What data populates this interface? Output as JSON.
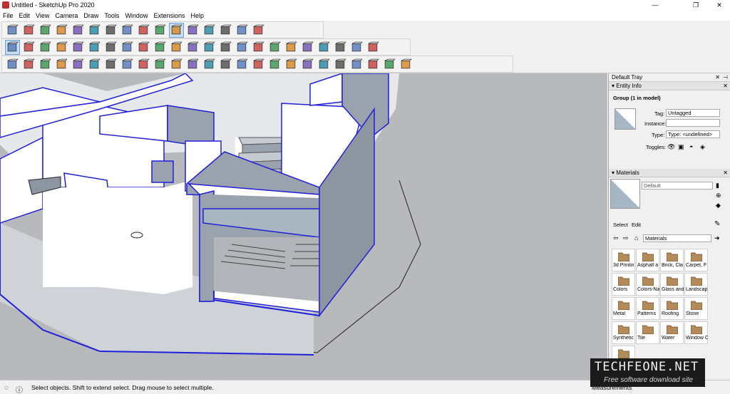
{
  "window": {
    "title": "Untitled - SketchUp Pro 2020",
    "minimize": "—",
    "maximize": "❐",
    "close": "✕"
  },
  "menu": [
    "File",
    "Edit",
    "View",
    "Camera",
    "Draw",
    "Tools",
    "Window",
    "Extensions",
    "Help"
  ],
  "toolbars": {
    "row1_icons": [
      "iso-view-icon",
      "top-view-icon",
      "front-view-icon",
      "right-view-icon",
      "back-view-icon",
      "left-view-icon",
      "xray-icon",
      "back-edges-icon",
      "wireframe-icon",
      "hidden-line-icon",
      "shaded-icon",
      "shaded-textures-icon",
      "monochrome-icon",
      "warehouse-icon",
      "ext-warehouse-icon",
      "share-model-icon"
    ],
    "row2_icons": [
      "select-icon",
      "eraser-icon",
      "pencil-icon",
      "arc-icon",
      "shape-icon",
      "paint-bucket-icon",
      "push-pull-icon",
      "follow-me-icon",
      "move-icon",
      "rotate-icon",
      "scale-icon",
      "offset-icon",
      "tape-measure-icon",
      "text-icon",
      "protractor-icon",
      "axes-icon",
      "dimension-icon",
      "zoom-icon",
      "zoom-extents-icon",
      "section-plane-icon",
      "outliner-icon",
      "instructor-icon",
      "account-icon"
    ],
    "row3_icons": [
      "sandbox-from-contours-icon",
      "sandbox-from-scratch-icon",
      "smoove-icon",
      "stamp-icon",
      "drape-icon",
      "add-detail-icon",
      "flip-edge-icon",
      "walk-icon",
      "look-around-icon",
      "position-camera-icon",
      "section-fill-icon",
      "display-sections-icon",
      "style-icon",
      "shadows-icon",
      "fog-icon",
      "2d-view-icon",
      "3d-warehouse-icon",
      "solid-tools-icon",
      "outer-shell-icon",
      "intersect-icon",
      "union-icon",
      "subtract-icon",
      "trim-icon",
      "split-icon",
      "hand-cursor-icon"
    ]
  },
  "tray": {
    "title": "Default Tray",
    "entity_info": {
      "header": "Entity Info",
      "selection": "Group (1 in model)",
      "tag_label": "Tag:",
      "tag_value": "Untagged",
      "instance_label": "Instance:",
      "instance_value": "",
      "type_label": "Type:",
      "type_value": "Type: <undefined>",
      "toggles_label": "Toggles:"
    },
    "materials": {
      "header": "Materials",
      "current": "Default",
      "tab_select": "Select",
      "tab_edit": "Edit",
      "library": "Materials",
      "categories": [
        "3d Printin",
        "Asphalt a",
        "Brick, Cla",
        "Carpet, F",
        "Colors",
        "Colors-Na",
        "Glass and",
        "Landscap",
        "Metal",
        "Patterns",
        "Roofing",
        "Stone",
        "Synthetic",
        "Tile",
        "Water",
        "Window C",
        ""
      ]
    }
  },
  "status": {
    "message": "Select objects. Shift to extend select. Drag mouse to select multiple.",
    "measurements": "Measurements"
  },
  "watermark": {
    "line1": "TECHFEONE.NET",
    "line2": "Free software download site"
  },
  "colors": {
    "accent": "#2020d8",
    "wall": "#ffffff",
    "wall_side": "#9aa3ad",
    "sky": "#b7b9bc"
  }
}
